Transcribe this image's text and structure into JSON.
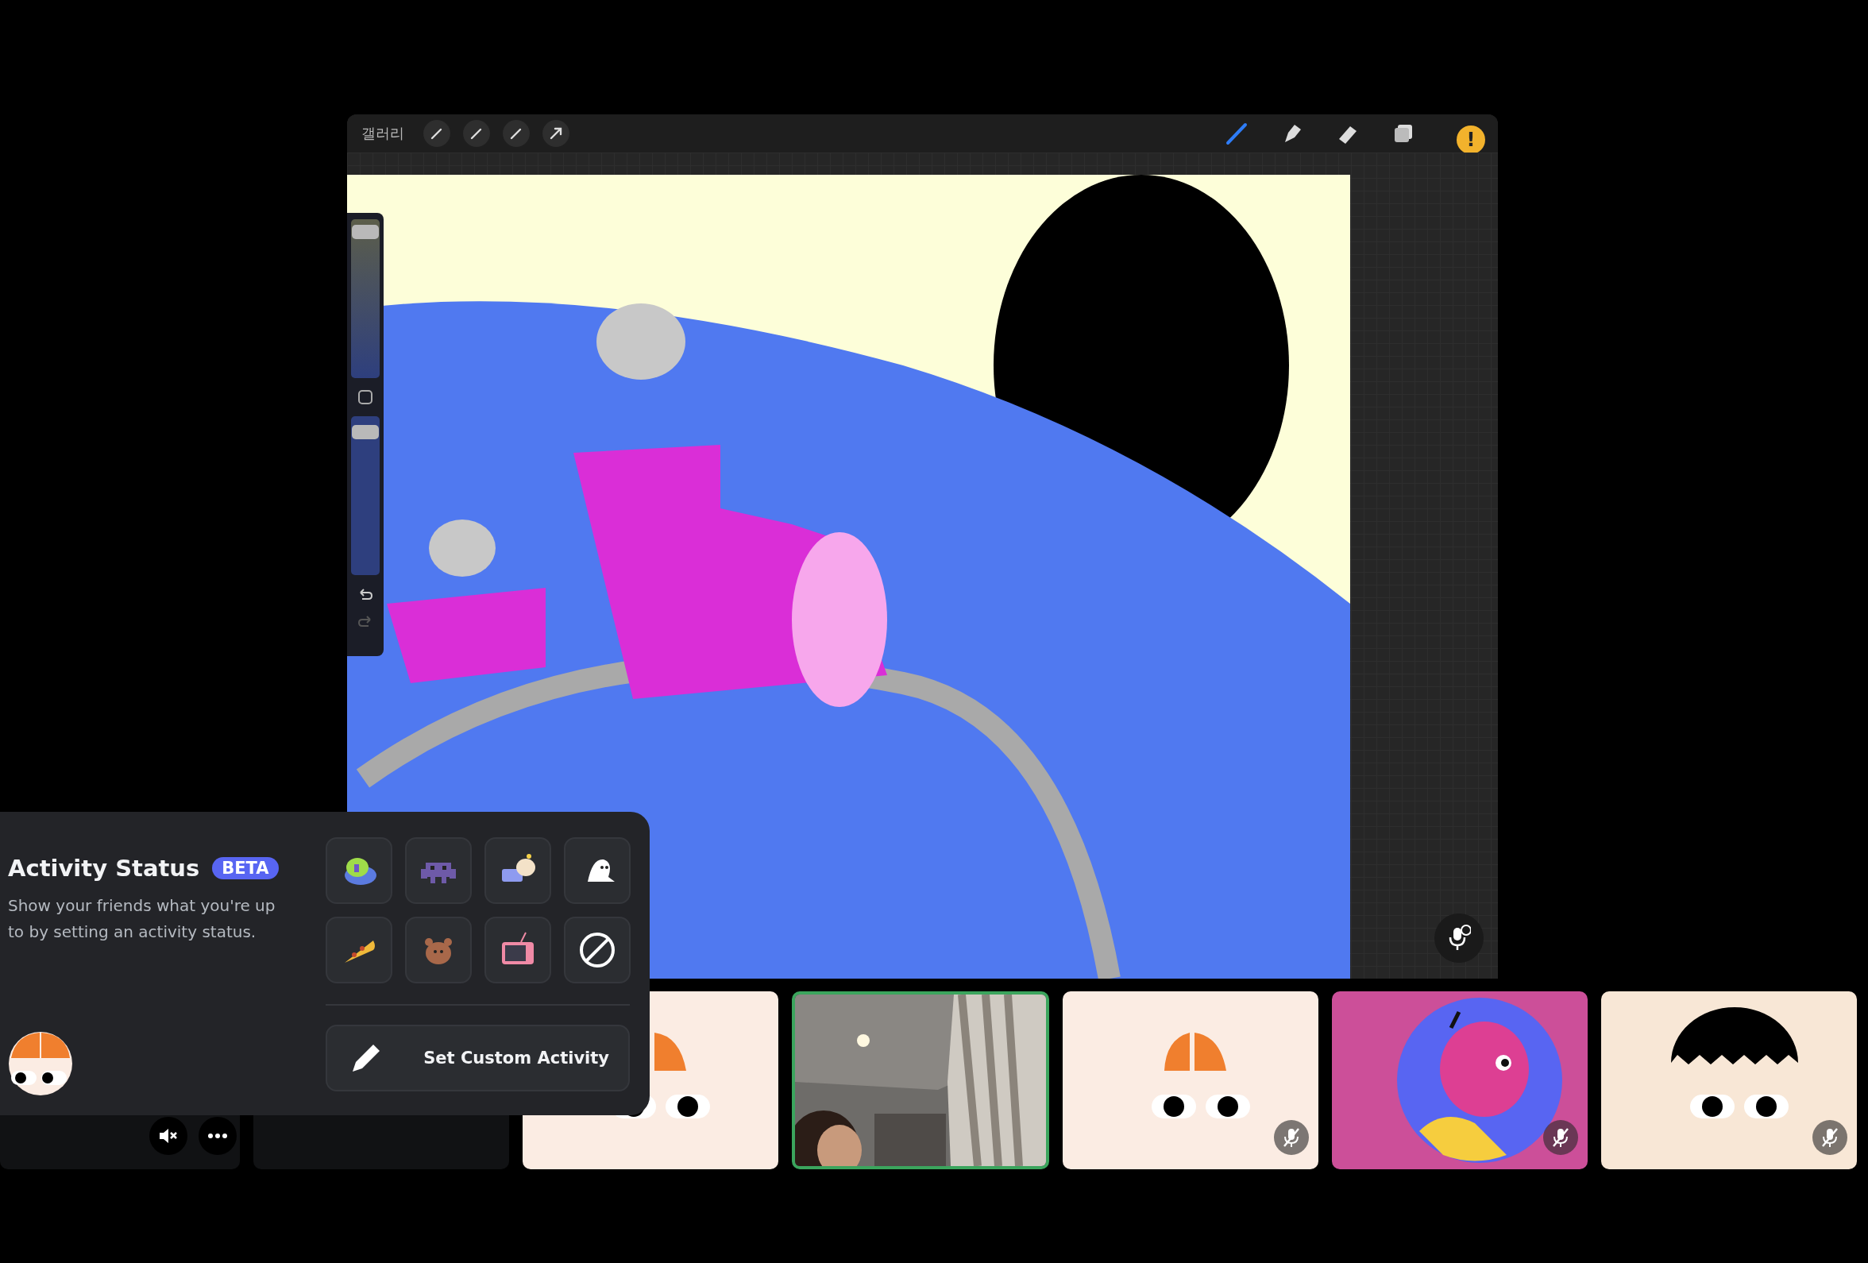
{
  "stream": {
    "toolbar": {
      "gallery_label": "갤러리",
      "warning_badge": "!"
    },
    "side_sliders": [
      {
        "kind": "size",
        "level": 0.96
      },
      {
        "kind": "opacity",
        "level": 0.94
      }
    ]
  },
  "activity_panel": {
    "title": "Activity Status",
    "badge": "BETA",
    "description": "Show your friends what you're up to by setting an activity status.",
    "activities": [
      {
        "kind": "sticker"
      },
      {
        "kind": "sticker"
      },
      {
        "kind": "sticker"
      },
      {
        "kind": "sticker"
      },
      {
        "kind": "sticker"
      },
      {
        "kind": "sticker"
      },
      {
        "kind": "sticker"
      },
      {
        "kind": "clear"
      }
    ],
    "custom_button": "Set Custom Activity"
  },
  "tiles": [
    {
      "kind": "dark",
      "selected": false,
      "speaker_muted": true,
      "has_menu": true
    },
    {
      "kind": "dark",
      "selected": false
    },
    {
      "kind": "orange",
      "selected": false
    },
    {
      "kind": "video",
      "selected": true
    },
    {
      "kind": "orange",
      "selected": false,
      "muted": true
    },
    {
      "kind": "character",
      "selected": false,
      "muted": true
    },
    {
      "kind": "spiky",
      "selected": false,
      "muted": true
    }
  ]
}
